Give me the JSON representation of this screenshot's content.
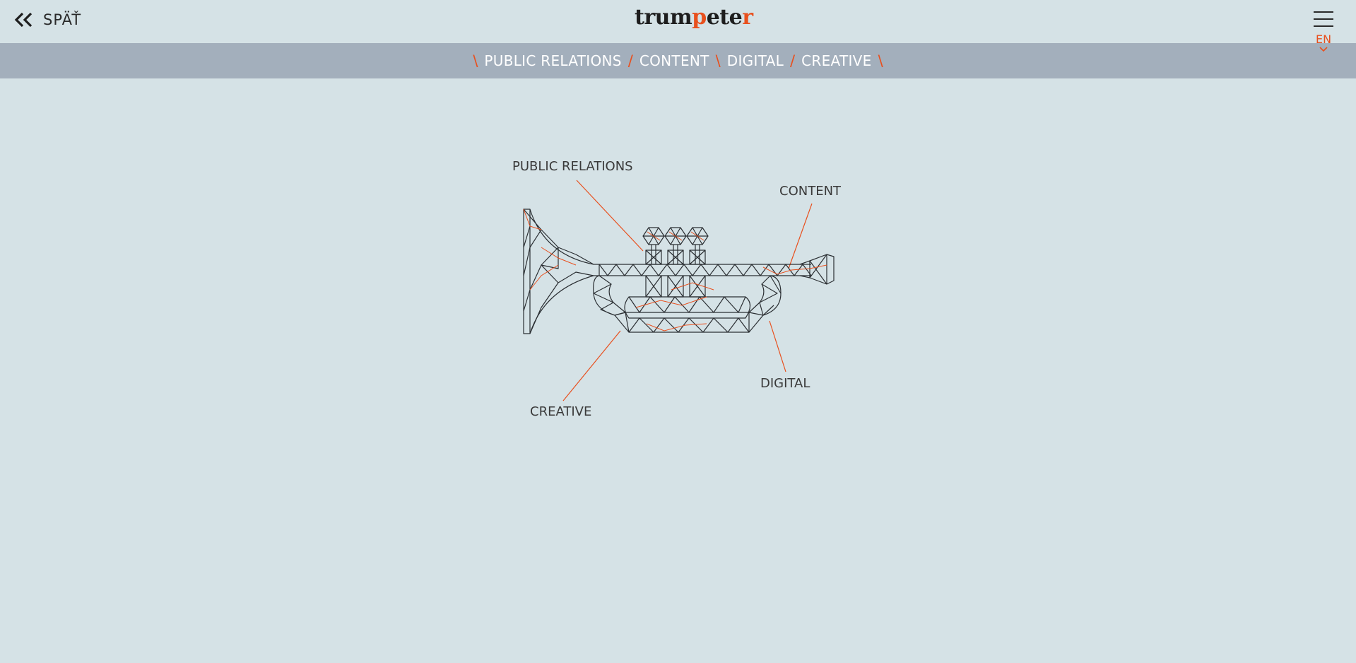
{
  "header": {
    "back_label": "SPÄŤ",
    "logo": {
      "part1": "trum",
      "part2": "p",
      "part3": "ete",
      "part4": "r"
    },
    "language": "EN"
  },
  "nav": {
    "separators": [
      "\\",
      "/",
      "\\",
      "/",
      "\\"
    ],
    "items": [
      {
        "label": "PUBLIC RELATIONS"
      },
      {
        "label": "CONTENT"
      },
      {
        "label": "DIGITAL"
      },
      {
        "label": "CREATIVE"
      }
    ]
  },
  "diagram": {
    "labels": {
      "public_relations": "PUBLIC RELATIONS",
      "content": "CONTENT",
      "digital": "DIGITAL",
      "creative": "CREATIVE"
    }
  },
  "colors": {
    "background": "#d5e2e6",
    "nav_bar": "#a3afbc",
    "accent": "#e8501e",
    "text": "#2a2a2a"
  },
  "icons": {
    "back": "double-chevron-left-icon",
    "menu": "hamburger-icon",
    "language_dropdown": "chevron-down-icon"
  }
}
